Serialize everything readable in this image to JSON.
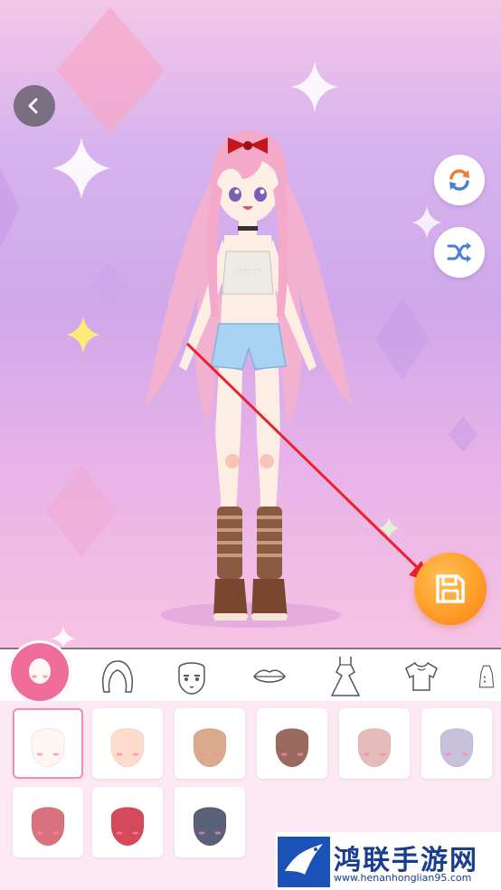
{
  "toolbar": {
    "back": "back-arrow-icon",
    "reset": "refresh-icon",
    "shuffle": "shuffle-icon",
    "save": "save-floppy-icon"
  },
  "categories": [
    {
      "id": "skin",
      "icon": "face-skin-icon",
      "active": true
    },
    {
      "id": "hair",
      "icon": "hair-icon",
      "active": false
    },
    {
      "id": "face",
      "icon": "face-features-icon",
      "active": false
    },
    {
      "id": "mouth",
      "icon": "lips-icon",
      "active": false
    },
    {
      "id": "dress",
      "icon": "dress-icon",
      "active": false
    },
    {
      "id": "top",
      "icon": "shirt-icon",
      "active": false
    },
    {
      "id": "more",
      "icon": "outfit-icon",
      "active": false
    }
  ],
  "skin_colors": [
    "#fff6f1",
    "#fddccb",
    "#dba98c",
    "#9b6a5e",
    "#e6bcbb",
    "#c8c1dc",
    "#d9727d",
    "#d44a5a",
    "#5a607a"
  ],
  "selected_skin": 0,
  "watermark": {
    "title": "鸿联手游网",
    "url": "www.henanhonglian95.com"
  }
}
